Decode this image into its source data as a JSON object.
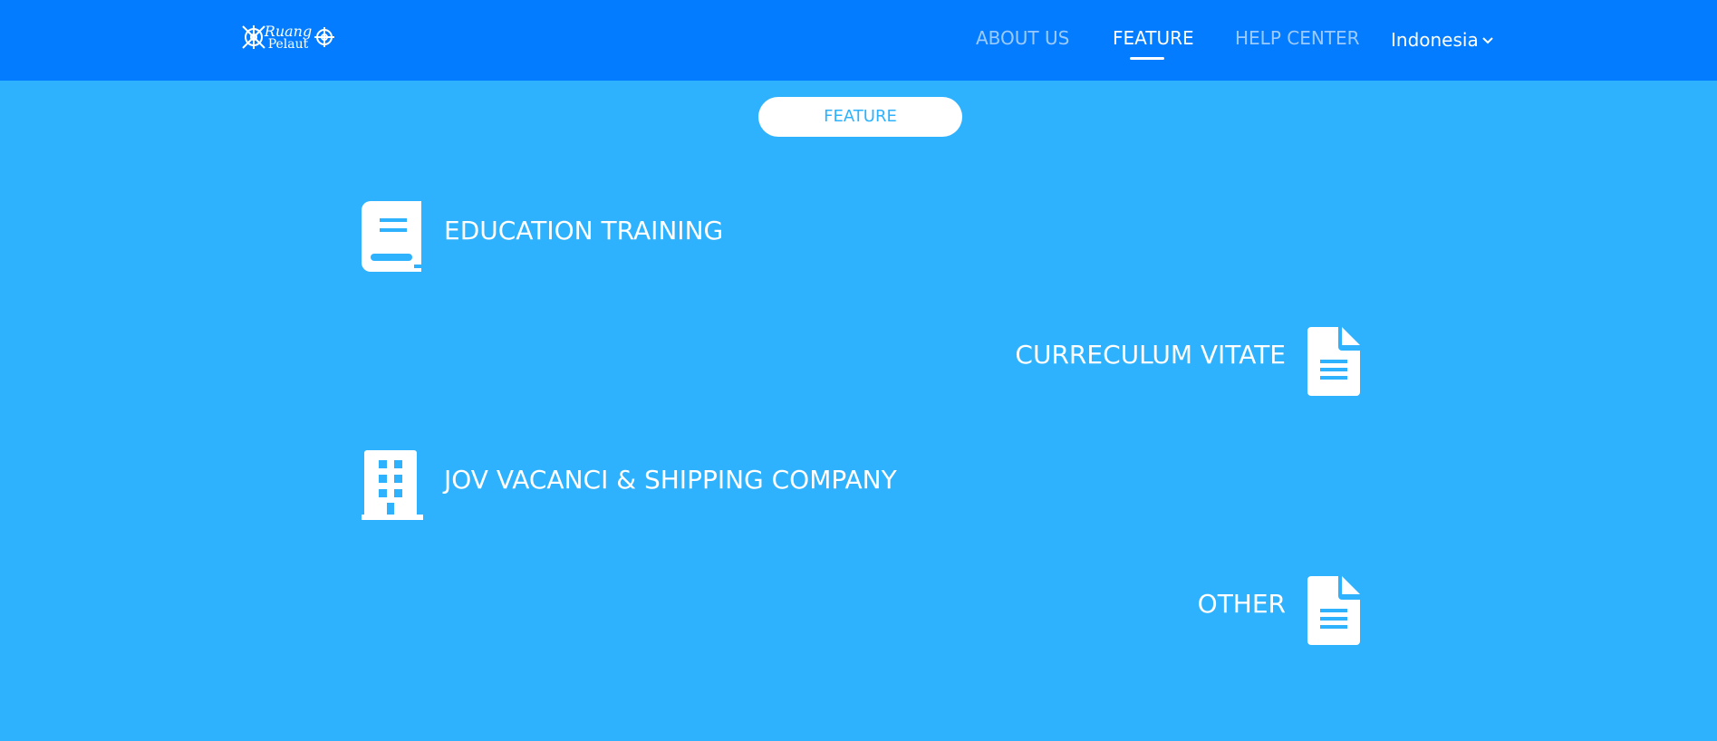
{
  "header": {
    "logo_icon": "ruang-pelaut-logo",
    "logo_line1": "Ruang",
    "logo_line2": "Pelaut",
    "nav": [
      {
        "label": "ABOUT US",
        "active": false
      },
      {
        "label": "FEATURE",
        "active": true
      },
      {
        "label": "HELP CENTER",
        "active": false
      }
    ],
    "language": {
      "label": "Indonesia",
      "icon": "chevron-down-icon"
    }
  },
  "section": {
    "pill_label": "FEATURE"
  },
  "features": [
    {
      "label": "EDUCATION TRAINING",
      "icon": "book-icon"
    },
    {
      "label": "CURRECULUM VITATE",
      "icon": "document-icon"
    },
    {
      "label": "JOV VACANCI & SHIPPING COMPANY",
      "icon": "building-icon"
    },
    {
      "label": "OTHER",
      "icon": "document-icon"
    }
  ],
  "colors": {
    "header_bg": "#037cff",
    "page_bg": "#2eb2fe",
    "text": "#ffffff",
    "accent_text": "#2eb2fe"
  }
}
